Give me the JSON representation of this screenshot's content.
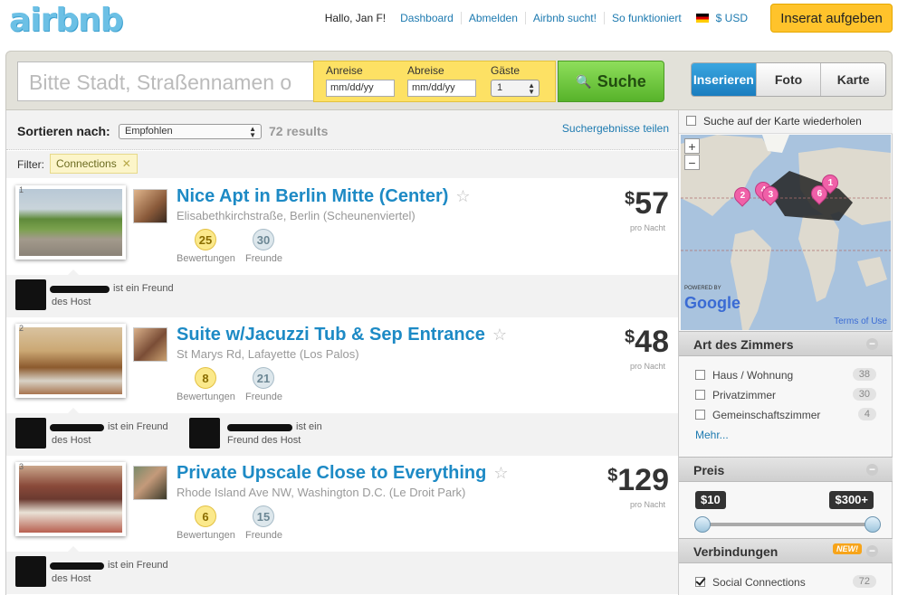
{
  "header": {
    "logo": "airbnb",
    "greeting": "Hallo, Jan F!",
    "links": [
      "Dashboard",
      "Abmelden",
      "Airbnb sucht!",
      "So funktioniert"
    ],
    "currency": "$ USD",
    "list_button": "Inserat aufgeben"
  },
  "search": {
    "placeholder": "Bitte Stadt, Straßennamen o",
    "checkin_label": "Anreise",
    "checkin_placeholder": "mm/dd/yy",
    "checkout_label": "Abreise",
    "checkout_placeholder": "mm/dd/yy",
    "guests_label": "Gäste",
    "guests_value": "1",
    "button": "Suche"
  },
  "view_tabs": [
    "Inserieren",
    "Foto",
    "Karte"
  ],
  "sort": {
    "label": "Sortieren nach:",
    "value": "Empfohlen",
    "results": "72 results",
    "share": "Suchergebnisse teilen"
  },
  "filter": {
    "label": "Filter:",
    "tag": "Connections"
  },
  "listings": [
    {
      "index": "1",
      "title": "Nice Apt in Berlin Mitte (Center)",
      "address": "Elisabethkirchstraße, Berlin (Scheunenviertel)",
      "reviews": "25",
      "reviews_label": "Bewertungen",
      "friends": "30",
      "friends_label": "Freunde",
      "currency": "$",
      "price": "57",
      "per_night": "pro Nacht",
      "friend_note_a": "ist ein Freund",
      "friend_note_b": "des Host"
    },
    {
      "index": "2",
      "title": "Suite w/Jacuzzi Tub & Sep Entrance",
      "address": "St Marys Rd, Lafayette (Los Palos)",
      "reviews": "8",
      "reviews_label": "Bewertungen",
      "friends": "21",
      "friends_label": "Freunde",
      "currency": "$",
      "price": "48",
      "per_night": "pro Nacht",
      "friend_note_a": "ist ein Freund",
      "friend_note_b": "des Host",
      "friend2_note_a": "ist ein",
      "friend2_note_b": "Freund des Host"
    },
    {
      "index": "3",
      "title": "Private Upscale Close to Everything",
      "address": "Rhode Island Ave NW, Washington D.C. (Le Droit Park)",
      "reviews": "6",
      "reviews_label": "Bewertungen",
      "friends": "15",
      "friends_label": "Freunde",
      "currency": "$",
      "price": "129",
      "per_night": "pro Nacht",
      "friend_note_a": "ist ein Freund",
      "friend_note_b": "des Host"
    }
  ],
  "sidebar": {
    "repeat_search": "Suche auf der Karte wiederholen",
    "map": {
      "zoom_in": "+",
      "zoom_out": "−",
      "pins": [
        "2",
        "4",
        "3",
        "6",
        "1"
      ],
      "powered_by": "POWERED BY",
      "google": "Google",
      "terms": "Terms of Use"
    },
    "room_type": {
      "title": "Art des Zimmers",
      "options": [
        {
          "label": "Haus / Wohnung",
          "count": "38"
        },
        {
          "label": "Privatzimmer",
          "count": "30"
        },
        {
          "label": "Gemeinschaftszimmer",
          "count": "4"
        }
      ],
      "more": "Mehr..."
    },
    "price": {
      "title": "Preis",
      "min": "$10",
      "max": "$300+"
    },
    "connections": {
      "title": "Verbindungen",
      "new_badge": "NEW!",
      "option": "Social Connections",
      "count": "72"
    }
  },
  "colors": {
    "accent": "#1d8ac5",
    "search_button": "#57b32a",
    "list_button": "#ffc32b",
    "pin": "#f060a8"
  }
}
